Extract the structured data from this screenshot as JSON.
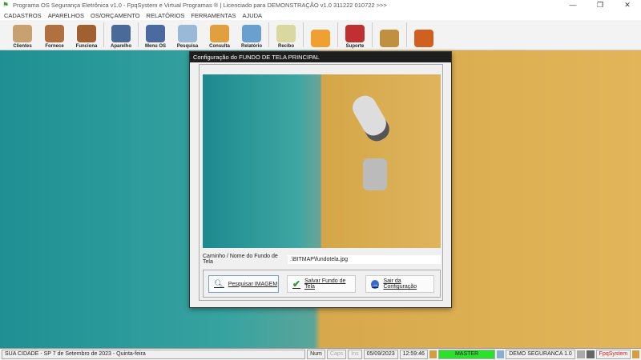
{
  "window": {
    "title": "Programa OS Segurança Eletrônica v1.0 - FpqSystem e Virtual Programas ® | Licenciado para  DEMONSTRAÇÃO v1.0 311222 010722 >>>",
    "minimize": "—",
    "maximize": "❐",
    "close": "✕"
  },
  "menu": [
    "CADASTROS",
    "APARELHOS",
    "OS/ORÇAMENTO",
    "RELATÓRIOS",
    "FERRAMENTAS",
    "AJUDA"
  ],
  "toolbar": [
    {
      "label": "Clientes",
      "color": "#c9a070"
    },
    {
      "label": "Fornece",
      "color": "#b07040"
    },
    {
      "label": "Funciona",
      "color": "#a06030"
    },
    {
      "label": "Aparelho",
      "color": "#4a6a9a"
    },
    {
      "label": "Menu OS",
      "color": "#4a6aa0"
    },
    {
      "label": "Pesquisa",
      "color": "#9ab8d8"
    },
    {
      "label": "Consulta",
      "color": "#e0a040"
    },
    {
      "label": "Relatório",
      "color": "#6aa0d0"
    },
    {
      "label": "Recibo",
      "color": "#d8d8a0"
    },
    {
      "label": "",
      "color": "#f0a030"
    },
    {
      "label": "Suporte",
      "color": "#c03030"
    },
    {
      "label": "",
      "color": "#c09040"
    },
    {
      "label": "",
      "color": "#d06020"
    }
  ],
  "dialog": {
    "title": "Configuração do FUNDO DE TELA PRINCIPAL",
    "path_label": "Caminho / Nome do Fundo de Tela",
    "path_value": ".\\BITMAP\\fundotela.jpg",
    "btn_search": "Pesquisar IMAGEM",
    "btn_save": "Salvar Fundo de Tela",
    "btn_exit": "Sair da Configuração"
  },
  "status": {
    "city": "SUA CIDADE - SP  7 de Setembro de 2023 - Quinta-feira",
    "num": "Num",
    "caps": "Caps",
    "ins": "Ins",
    "date": "05/09/2023",
    "time": "12:59:46",
    "user": "MASTER",
    "company": "DEMO SEGURANCA 1.0",
    "brand": "FpqSystem"
  }
}
